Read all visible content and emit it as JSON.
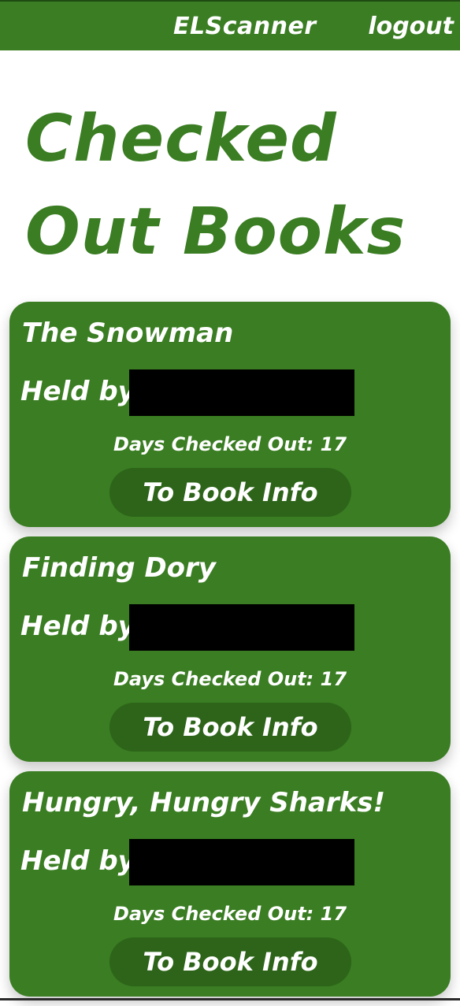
{
  "app": {
    "brand": "ELScanner",
    "logout_label": "logout"
  },
  "page": {
    "title": "Checked Out Books"
  },
  "books": [
    {
      "title": "The Snowman",
      "held_label": "Held by:",
      "held_value": "",
      "days_label": "Days Checked Out:",
      "days_value": "17",
      "button_label": "To Book Info"
    },
    {
      "title": "Finding Dory",
      "held_label": "Held by:",
      "held_value": "",
      "days_label": "Days Checked Out:",
      "days_value": "17",
      "button_label": "To Book Info"
    },
    {
      "title": "Hungry, Hungry Sharks!",
      "held_label": "Held by:",
      "held_value": "",
      "days_label": "Days Checked Out:",
      "days_value": "17",
      "button_label": "To Book Info"
    }
  ],
  "colors": {
    "brand_green": "#3a7d22",
    "button_green": "#2d6419",
    "redaction": "#000000"
  }
}
